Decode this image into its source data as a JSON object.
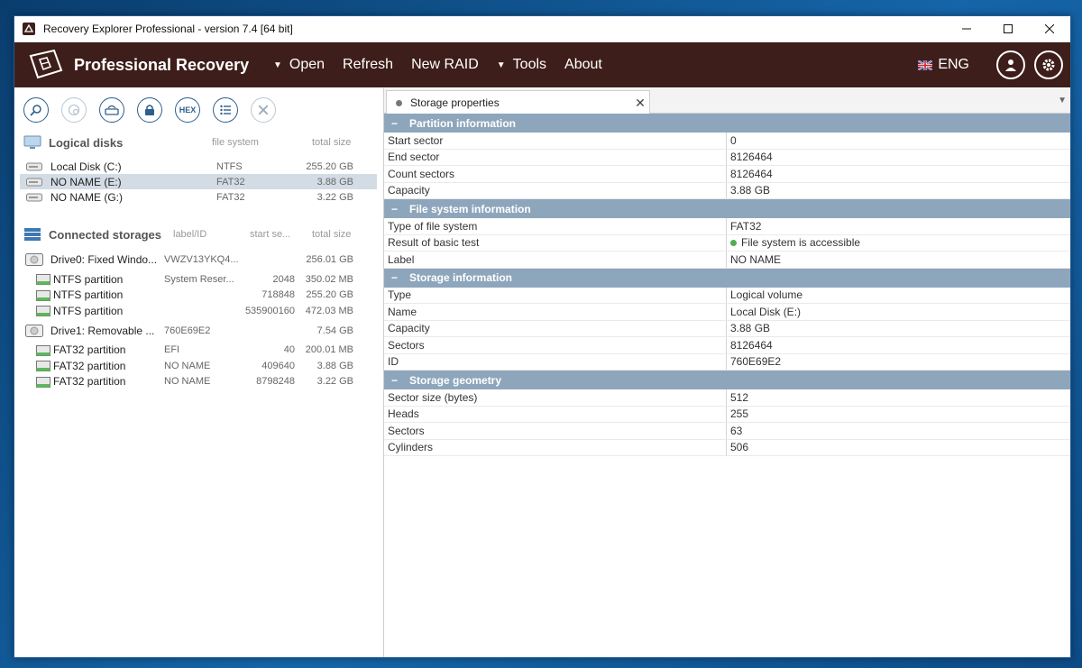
{
  "window": {
    "title": "Recovery Explorer Professional - version 7.4 [64 bit]"
  },
  "menubar": {
    "brand": "Professional Recovery",
    "items": [
      {
        "label": "Open",
        "arrow": true
      },
      {
        "label": "Refresh",
        "arrow": false
      },
      {
        "label": "New RAID",
        "arrow": false
      },
      {
        "label": "Tools",
        "arrow": true
      },
      {
        "label": "About",
        "arrow": false
      }
    ],
    "language": "ENG"
  },
  "toolbar": {
    "hex_label": "HEX"
  },
  "logical_disks": {
    "title": "Logical disks",
    "col_fs": "file system",
    "col_size": "total size",
    "items": [
      {
        "name": "Local Disk (C:)",
        "fs": "NTFS",
        "size": "255.20 GB"
      },
      {
        "name": "NO NAME (E:)",
        "fs": "FAT32",
        "size": "3.88 GB"
      },
      {
        "name": "NO NAME (G:)",
        "fs": "FAT32",
        "size": "3.22 GB"
      }
    ]
  },
  "storages": {
    "title": "Connected storages",
    "col_label": "label/ID",
    "col_start": "start se...",
    "col_size": "total size",
    "drives": [
      {
        "name": "Drive0: Fixed Windo...",
        "label": "VWZV13YKQ4...",
        "start": "",
        "size": "256.01 GB",
        "partitions": [
          {
            "name": "NTFS partition",
            "label": "System Reser...",
            "start": "2048",
            "size": "350.02 MB"
          },
          {
            "name": "NTFS partition",
            "label": "",
            "start": "718848",
            "size": "255.20 GB"
          },
          {
            "name": "NTFS partition",
            "label": "",
            "start": "535900160",
            "size": "472.03 MB"
          }
        ]
      },
      {
        "name": "Drive1: Removable ...",
        "label": "760E69E2",
        "start": "",
        "size": "7.54 GB",
        "partitions": [
          {
            "name": "FAT32 partition",
            "label": "EFI",
            "start": "40",
            "size": "200.01 MB"
          },
          {
            "name": "FAT32 partition",
            "label": "NO NAME",
            "start": "409640",
            "size": "3.88 GB"
          },
          {
            "name": "FAT32 partition",
            "label": "NO NAME",
            "start": "8798248",
            "size": "3.22 GB"
          }
        ]
      }
    ]
  },
  "panel": {
    "tab": "Storage properties",
    "sections": [
      {
        "title": "Partition information",
        "rows": [
          [
            "Start sector",
            "0"
          ],
          [
            "End sector",
            "8126464"
          ],
          [
            "Count sectors",
            "8126464"
          ],
          [
            "Capacity",
            "3.88 GB"
          ]
        ]
      },
      {
        "title": "File system information",
        "rows": [
          [
            "Type of file system",
            "FAT32"
          ],
          [
            "Result of basic test",
            "File system is accessible"
          ],
          [
            "Label",
            "NO NAME"
          ]
        ]
      },
      {
        "title": "Storage information",
        "rows": [
          [
            "Type",
            "Logical volume"
          ],
          [
            "Name",
            "Local Disk (E:)"
          ],
          [
            "Capacity",
            "3.88 GB"
          ],
          [
            "Sectors",
            "8126464"
          ],
          [
            "ID",
            "760E69E2"
          ]
        ]
      },
      {
        "title": "Storage geometry",
        "rows": [
          [
            "Sector size (bytes)",
            "512"
          ],
          [
            "Heads",
            "255"
          ],
          [
            "Sectors",
            "63"
          ],
          [
            "Cylinders",
            "506"
          ]
        ]
      }
    ]
  },
  "colors": {
    "menubar": "#3e1e1a",
    "section_header": "#8ea6bc",
    "selection": "#d3dce5",
    "accent": "#2d5f8d",
    "ok": "#4caf50"
  }
}
